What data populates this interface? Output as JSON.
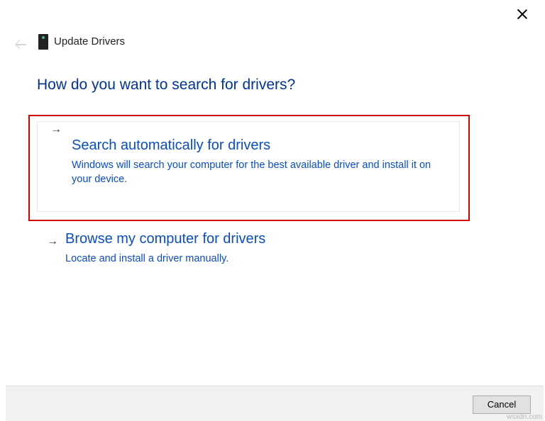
{
  "window_title": "Update Drivers",
  "heading": "How do you want to search for drivers?",
  "options": [
    {
      "title": "Search automatically for drivers",
      "description": "Windows will search your computer for the best available driver and install it on your device."
    },
    {
      "title": "Browse my computer for drivers",
      "description": "Locate and install a driver manually."
    }
  ],
  "buttons": {
    "cancel": "Cancel"
  },
  "watermark": "wsxdn.com"
}
